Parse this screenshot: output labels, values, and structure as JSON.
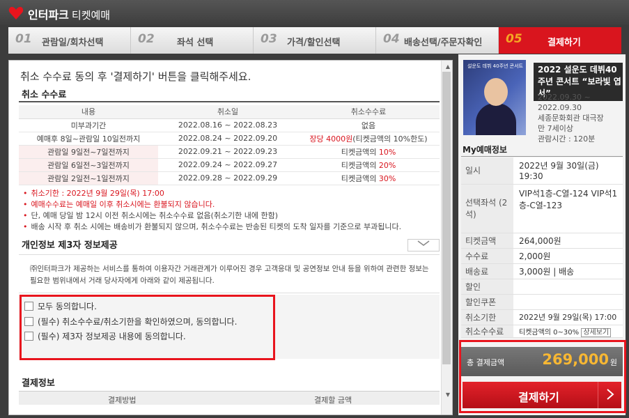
{
  "app": {
    "brand": "인터파크",
    "product": "티켓예매"
  },
  "steps": [
    {
      "num": "01",
      "label": "관람일/회차선택"
    },
    {
      "num": "02",
      "label": "좌석 선택"
    },
    {
      "num": "03",
      "label": "가격/할인선택"
    },
    {
      "num": "04",
      "label": "배송선택/주문자확인"
    },
    {
      "num": "05",
      "label": "결제하기"
    }
  ],
  "main": {
    "instruction": "취소 수수료 동의 후 '결제하기' 버튼을 클릭해주세요.",
    "cancel_fee": {
      "title": "취소 수수료",
      "headers": [
        "내용",
        "취소일",
        "취소수수료"
      ],
      "rows": [
        {
          "content": "미부과기간",
          "date": "2022.08.16 ~ 2022.08.23",
          "fee": "없음"
        },
        {
          "content": "예매후 8일~관람일 10일전까지",
          "date": "2022.08.24 ~ 2022.09.20",
          "fee_red": "장당 4000원",
          "fee": "(티켓금액의 10%한도)"
        },
        {
          "content": "관람일 9일전~7일전까지",
          "date": "2022.09.21 ~ 2022.09.23",
          "fee": "티켓금액의 ",
          "fee_red": "10%"
        },
        {
          "content": "관람일 6일전~3일전까지",
          "date": "2022.09.24 ~ 2022.09.27",
          "fee": "티켓금액의 ",
          "fee_red": "20%"
        },
        {
          "content": "관람일 2일전~1일전까지",
          "date": "2022.09.28 ~ 2022.09.29",
          "fee": "티켓금액의 ",
          "fee_red": "30%"
        }
      ],
      "notes": [
        "취소기한 : 2022년 9월 29일(목) 17:00",
        "예매수수료는 예매일 이후 취소시에는 환불되지 않습니다.",
        "단, 예매 당일 밤 12시 이전 취소시에는 취소수수료 없음(취소기한 내에 한함)",
        "배송 시작 후 취소 시에는 배송비가 환불되지 않으며, 취소수수료는 반송된 티켓의 도착 일자를 기준으로 부과됩니다."
      ]
    },
    "privacy": {
      "title": "개인정보 제3자 정보제공",
      "dropdown_icon": "chevron-down",
      "text": "㈜인터파크가 제공하는 서비스를 통하여 이용자간 거래관계가 이루어진 경우 고객응대 및 공연정보 안내 등을 위하여 관련한 정보는 필요한 범위내에서 거래 당사자에게 아래와 같이 제공됩니다."
    },
    "consents": [
      {
        "label": "모두 동의합니다.",
        "checked": false
      },
      {
        "label": "(필수) 취소수수료/취소기한을 확인하였으며, 동의합니다.",
        "checked": false
      },
      {
        "label": "(필수) 제3자 정보제공 내용에 동의합니다.",
        "checked": false
      }
    ],
    "payment": {
      "title": "결제정보",
      "headers": [
        "결제방법",
        "결제할 금액"
      ]
    }
  },
  "side": {
    "show": {
      "title": "2022 설운도 데뷔40주년 콘서트 “보라빛 엽서”",
      "dates": "2022.09.30 ~ 2022.09.30",
      "venue": "세종문화회관 대극장",
      "age": "만 7세이상",
      "runtime": "관람시간 : 120분",
      "poster_text": "설운도 데뷔 40주년 콘서트"
    },
    "my_title": "My예매정보",
    "info": [
      {
        "key": "일시",
        "value": "2022년 9월 30일(금) 19:30"
      },
      {
        "key": "선택좌석 (2석)",
        "value": "VIP석1층-C열-124 VIP석1층-C열-123"
      },
      {
        "key": "티켓금액",
        "value": "264,000원"
      },
      {
        "key": "수수료",
        "value": "2,000원"
      },
      {
        "key": "배송료",
        "value": "3,000원 | 배송"
      },
      {
        "key": "할인",
        "value": ""
      },
      {
        "key": "할인쿠폰",
        "value": ""
      },
      {
        "key": "취소기한",
        "value": "2022년 9월 29일(목) 17:00"
      },
      {
        "key": "취소수수료",
        "value": "티켓금액의 0~30%",
        "link": "상세보기"
      }
    ],
    "total_label": "총 결제금액",
    "total_amount": "269,000",
    "total_unit": "원",
    "pay_button": "결제하기",
    "pay_button_icon": "chevron-right"
  },
  "colors": {
    "brand_red": "#d9151e",
    "active_step_num": "#f5a623",
    "total_amount": "#f7b733",
    "highlight_outline": "#e8141d"
  }
}
